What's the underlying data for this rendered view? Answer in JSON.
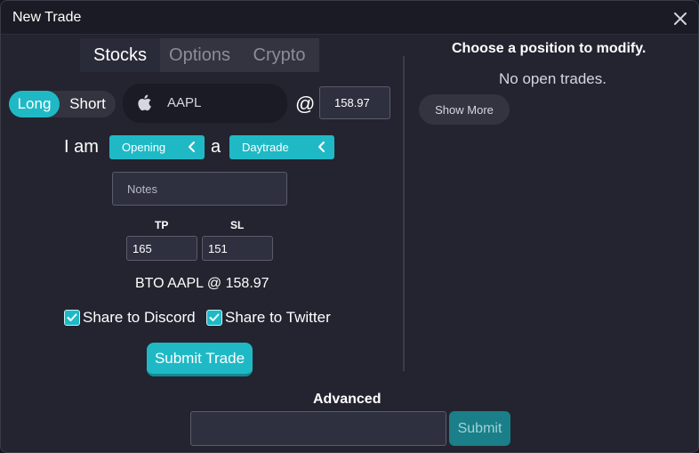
{
  "window": {
    "title": "New Trade"
  },
  "tabs": [
    {
      "label": "Stocks",
      "active": true
    },
    {
      "label": "Options",
      "active": false
    },
    {
      "label": "Crypto",
      "active": false
    }
  ],
  "direction": {
    "long_label": "Long",
    "short_label": "Short",
    "selected": "Long"
  },
  "ticker": {
    "symbol": "AAPL",
    "icon": "apple-icon"
  },
  "price": {
    "at": "@",
    "value": "158.97"
  },
  "sentence": {
    "i_am": "I am",
    "action": "Opening",
    "a": "a",
    "type": "Daytrade"
  },
  "notes": {
    "placeholder": "Notes"
  },
  "targets": {
    "tp_label": "TP",
    "tp_value": "165",
    "sl_label": "SL",
    "sl_value": "151"
  },
  "summary": "BTO AAPL @ 158.97",
  "share": {
    "discord_label": "Share to Discord",
    "discord_checked": true,
    "twitter_label": "Share to Twitter",
    "twitter_checked": true
  },
  "submit_trade_label": "Submit Trade",
  "right_panel": {
    "title": "Choose a position to modify.",
    "empty_text": "No open trades.",
    "show_more_label": "Show More"
  },
  "advanced": {
    "label": "Advanced",
    "input_value": "",
    "submit_label": "Submit"
  },
  "colors": {
    "accent": "#1fb9c6",
    "background": "#23242f",
    "panel": "#1a1b25"
  }
}
